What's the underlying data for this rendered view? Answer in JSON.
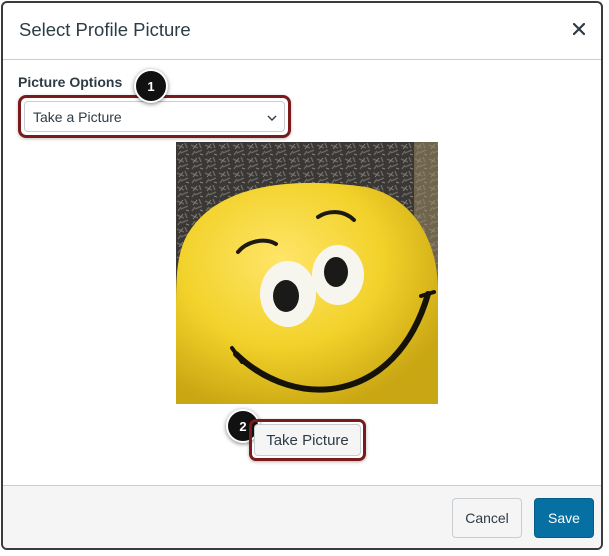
{
  "dialog": {
    "title": "Select Profile Picture",
    "close_icon": "close-icon"
  },
  "picture_options": {
    "label": "Picture Options",
    "selected": "Take a Picture"
  },
  "callouts": [
    "1",
    "2"
  ],
  "take_picture_label": "Take Picture",
  "footer": {
    "cancel_label": "Cancel",
    "save_label": "Save"
  },
  "colors": {
    "primary": "#0770a3",
    "highlight": "#7b1a1a",
    "text": "#2d3b45"
  }
}
